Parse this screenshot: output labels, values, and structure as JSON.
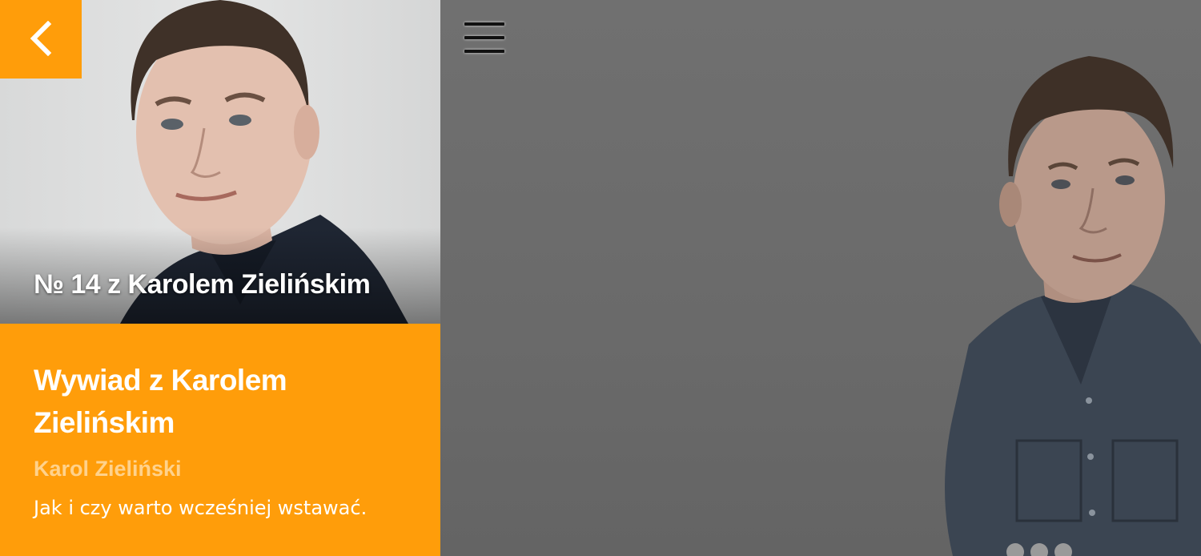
{
  "episode": {
    "label": "№ 14 z Karolem Zielińskim"
  },
  "article": {
    "title": "Wywiad z Karolem Zielińskim",
    "author": "Karol Zieliński",
    "description": "Jak i czy warto wcześniej wstawać."
  },
  "colors": {
    "accent": "#ff9d0a",
    "panel": "#6b6b6b",
    "author_text": "#ffd28c"
  },
  "icons": {
    "back": "chevron-left-icon",
    "menu": "hamburger-menu-icon"
  },
  "pagination": {
    "count": 3,
    "active": 1
  }
}
